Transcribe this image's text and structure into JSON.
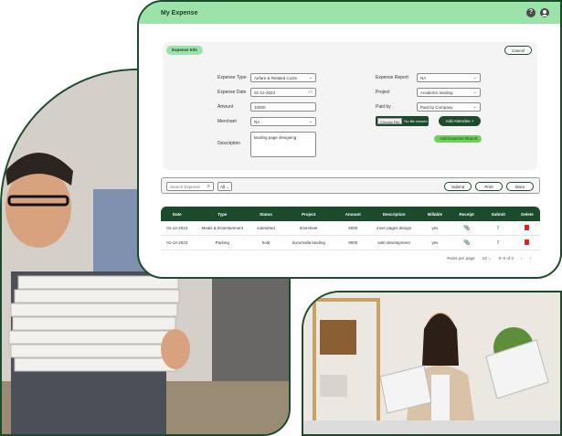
{
  "header": {
    "title": "My Expense",
    "help_icon": "?"
  },
  "form": {
    "section_label": "Expense Info",
    "cancel_label": "Cancel",
    "left": [
      {
        "label": "Expense Type",
        "value": "Airfare & Related Costs"
      },
      {
        "label": "Expense Date",
        "value": "01-12-2023"
      },
      {
        "label": "Amount",
        "value": "10000"
      },
      {
        "label": "Merchant",
        "value": "NA"
      },
      {
        "label": "Description",
        "value": "landing page designing"
      }
    ],
    "right": [
      {
        "label": "Expense Report",
        "value": "NA"
      },
      {
        "label": "Project",
        "value": "Academic landing"
      },
      {
        "label": "Paid by",
        "value": "Paid by Company"
      }
    ],
    "file_choose": "Choose File",
    "file_status": "No file chosen",
    "add_attendee": "Add Attendee +",
    "add_expense_report": "Add Expense Report"
  },
  "toolbar": {
    "search_placeholder": "Search Expense",
    "filter_value": "All",
    "submit_label": "Submit",
    "print_label": "Print",
    "more_label": "More"
  },
  "table": {
    "columns": [
      "Date",
      "Type",
      "Status",
      "Project",
      "Amount",
      "Description",
      "Billable",
      "Receipt",
      "Submit",
      "Delete"
    ],
    "rows": [
      {
        "date": "01-12-2023",
        "type": "Meals & Entertainment",
        "status": "submitted",
        "project": "timesheet",
        "amount": "5000",
        "description": "inner pages design",
        "billable": "yes"
      },
      {
        "date": "01-12-2023",
        "type": "Parking",
        "status": "hold",
        "project": "bocumalla landing",
        "amount": "9000",
        "description": "web development",
        "billable": "yes"
      }
    ],
    "rows_per_page_label": "Rows per page",
    "rows_per_page": "10",
    "range": "0–0 of 0"
  },
  "colors": {
    "brand_dark": "#1c4b2c",
    "brand_light": "#9be3a9",
    "accent": "#6fcf5a",
    "delete": "#e02020"
  }
}
